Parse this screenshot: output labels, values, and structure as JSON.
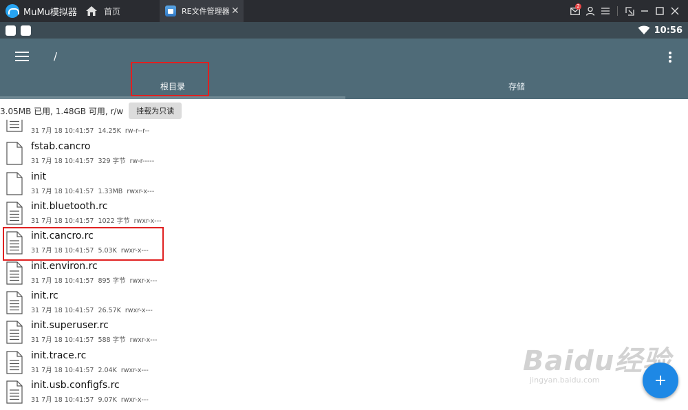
{
  "emulator": {
    "app_name": "MuMu模拟器",
    "home_tab_label": "首页",
    "active_tab_label": "RE文件管理器",
    "notification_count": "2",
    "icons": [
      "mumu-logo-icon",
      "home-icon",
      "app-icon",
      "close-icon",
      "mail-icon",
      "user-icon",
      "screen-shot-icon",
      "minimize-icon",
      "maximize-icon",
      "window-close-icon"
    ]
  },
  "status_bar": {
    "time": "10:56",
    "icons": [
      "wifi-icon"
    ]
  },
  "toolbar": {
    "path": "/",
    "tabs": [
      {
        "label": "根目录",
        "selected": true
      },
      {
        "label": "存储",
        "selected": false
      }
    ]
  },
  "storage": {
    "info": "3.05MB 已用, 1.48GB 可用, r/w",
    "mount_button_label": "挂载为只读"
  },
  "files": [
    {
      "name": "",
      "date": "31 7月 18 10:41:57",
      "size": "14.25K",
      "perm": "rw-r--r--",
      "icon": "text-file-icon"
    },
    {
      "name": "fstab.cancro",
      "date": "31 7月 18 10:41:57",
      "size": "329 字节",
      "perm": "rw-r-----",
      "icon": "blank-file-icon"
    },
    {
      "name": "init",
      "date": "31 7月 18 10:41:57",
      "size": "1.33MB",
      "perm": "rwxr-x---",
      "icon": "blank-file-icon"
    },
    {
      "name": "init.bluetooth.rc",
      "date": "31 7月 18 10:41:57",
      "size": "1022 字节",
      "perm": "rwxr-x---",
      "icon": "text-file-icon"
    },
    {
      "name": "init.cancro.rc",
      "date": "31 7月 18 10:41:57",
      "size": "5.03K",
      "perm": "rwxr-x---",
      "icon": "text-file-icon"
    },
    {
      "name": "init.environ.rc",
      "date": "31 7月 18 10:41:57",
      "size": "895 字节",
      "perm": "rwxr-x---",
      "icon": "text-file-icon"
    },
    {
      "name": "init.rc",
      "date": "31 7月 18 10:41:57",
      "size": "26.57K",
      "perm": "rwxr-x---",
      "icon": "text-file-icon"
    },
    {
      "name": "init.superuser.rc",
      "date": "31 7月 18 10:41:57",
      "size": "588 字节",
      "perm": "rwxr-x---",
      "icon": "text-file-icon"
    },
    {
      "name": "init.trace.rc",
      "date": "31 7月 18 10:41:57",
      "size": "2.04K",
      "perm": "rwxr-x---",
      "icon": "text-file-icon"
    },
    {
      "name": "init.usb.configfs.rc",
      "date": "31 7月 18 10:41:57",
      "size": "9.07K",
      "perm": "rwxr-x---",
      "icon": "text-file-icon"
    }
  ],
  "watermark": {
    "main": "Baidu经验",
    "sub": "jingyan.baidu.com"
  },
  "colors": {
    "toolbar": "#4f6b78",
    "status_bar": "#3c4b54",
    "fab": "#1e88e5",
    "highlight": "#e02020"
  }
}
